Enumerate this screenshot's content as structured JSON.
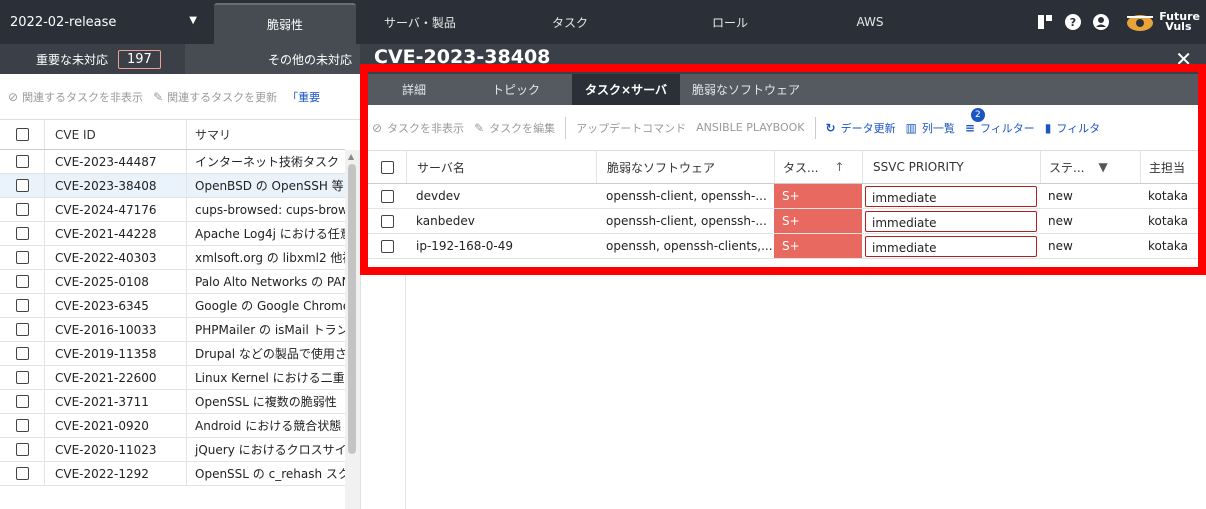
{
  "topbar": {
    "release": "2022-02-release",
    "tabs": [
      {
        "label": "脆弱性"
      },
      {
        "label": "サーバ・製品"
      },
      {
        "label": "タスク"
      },
      {
        "label": "ロール"
      },
      {
        "label": "AWS"
      }
    ],
    "icons": [
      "dashboard-icon",
      "help-icon",
      "account-icon"
    ],
    "logo": {
      "line1": "Future",
      "line2": "Vuls"
    }
  },
  "left": {
    "tabs": {
      "important_label": "重要な未対応",
      "important_count": "197",
      "other_label": "その他の未対応"
    },
    "toolbar": {
      "hide_related": "関連するタスクを非表示",
      "update_related": "関連するタスクを更新",
      "link": "「重要"
    },
    "columns": {
      "cve": "CVE ID",
      "summary": "サマリ"
    },
    "rows": [
      {
        "cve": "CVE-2023-44487",
        "summary": "インターネット技術タスク"
      },
      {
        "cve": "CVE-2023-38408",
        "summary": "OpenBSD の OpenSSH 等"
      },
      {
        "cve": "CVE-2024-47176",
        "summary": "cups-browsed: cups-brows"
      },
      {
        "cve": "CVE-2021-44228",
        "summary": "Apache Log4j における任意"
      },
      {
        "cve": "CVE-2022-40303",
        "summary": "xmlsoft.org の libxml2 他複"
      },
      {
        "cve": "CVE-2025-0108",
        "summary": "Palo Alto Networks の PAN"
      },
      {
        "cve": "CVE-2023-6345",
        "summary": "Google の Google Chrome"
      },
      {
        "cve": "CVE-2016-10033",
        "summary": "PHPMailer の isMail トラン"
      },
      {
        "cve": "CVE-2019-11358",
        "summary": "Drupal などの製品で使用さ"
      },
      {
        "cve": "CVE-2021-22600",
        "summary": "Linux Kernel における二重"
      },
      {
        "cve": "CVE-2021-3711",
        "summary": "OpenSSL に複数の脆弱性"
      },
      {
        "cve": "CVE-2021-0920",
        "summary": "Android における競合状態"
      },
      {
        "cve": "CVE-2020-11023",
        "summary": "jQuery におけるクロスサイ"
      },
      {
        "cve": "CVE-2022-1292",
        "summary": "OpenSSL の c_rehash スク"
      }
    ]
  },
  "detail": {
    "title": "CVE-2023-38408",
    "tabs": [
      {
        "label": "詳細"
      },
      {
        "label": "トピック"
      },
      {
        "label": "タスク×サーバ"
      },
      {
        "label": "脆弱なソフトウェア"
      }
    ],
    "toolbar": {
      "hide_tasks": "タスクを非表示",
      "edit_tasks": "タスクを編集",
      "update_cmd": "アップデートコマンド",
      "ansible": "ANSIBLE PLAYBOOK",
      "refresh": "データ更新",
      "columns": "列一覧",
      "filter": "フィルター",
      "filter_count": "2",
      "saved_filter": "フィルタ"
    },
    "columns": {
      "server": "サーバ名",
      "software": "脆弱なソフトウェア",
      "task": "タス...",
      "ssvc": "SSVC PRIORITY",
      "status": "ステ...",
      "owner": "主担当"
    },
    "rows": [
      {
        "server": "devdev",
        "software": "openssh-client, openssh-...",
        "priority": "S+",
        "ssvc": "immediate",
        "status": "new",
        "owner": "kotaka"
      },
      {
        "server": "kanbedev",
        "software": "openssh-client, openssh-...",
        "priority": "S+",
        "ssvc": "immediate",
        "status": "new",
        "owner": "kotaka"
      },
      {
        "server": "ip-192-168-0-49",
        "software": "openssh, openssh-clients,...",
        "priority": "S+",
        "ssvc": "immediate",
        "status": "new",
        "owner": "kotaka"
      }
    ]
  },
  "colors": {
    "topbar": "#2b3038",
    "accent": "#1a56c2",
    "priority": "#e8695f",
    "highlight": "#ff0000"
  }
}
